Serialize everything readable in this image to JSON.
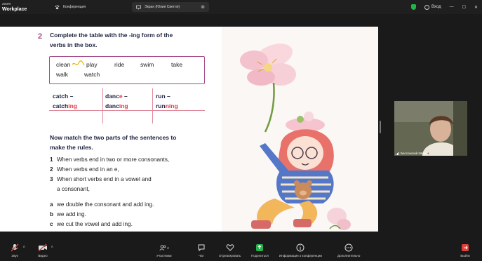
{
  "titlebar": {
    "brand_top": "zoom",
    "brand_main": "Workplace",
    "tab1_label": "Конференция",
    "tab2_label": "Экран (Юлия Светля)",
    "tab2_close": "⊗",
    "account_label": "Вход"
  },
  "exercise": {
    "number": "2",
    "instruction_line1": "Complete the table with the -ing form of the",
    "instruction_line2": "verbs in the box.",
    "box_words": [
      "clean",
      "play",
      "ride",
      "swim",
      "take",
      "walk",
      "watch"
    ],
    "table": [
      {
        "base": "catch –",
        "stem": "catch",
        "suffix": "ing"
      },
      {
        "base_pre": "danc",
        "base_red": "e",
        "base_post": " –",
        "stem": "danc",
        "suffix": "ing"
      },
      {
        "base": "run –",
        "stem": "run",
        "suffix": "ning"
      }
    ],
    "match_line1": "Now match the two parts of the sentences to",
    "match_line2": "make the rules.",
    "rules": [
      {
        "label": "1",
        "text": "When verbs end in two or more consonants,"
      },
      {
        "label": "2",
        "text": "When verbs end in an e,"
      },
      {
        "label": "3",
        "text": "When short verbs end in a vowel and"
      },
      {
        "label": "",
        "text": "a consonant,"
      }
    ],
    "answers": [
      {
        "label": "a",
        "text": "we double the consonant and add ing."
      },
      {
        "label": "b",
        "text": "we add ing."
      },
      {
        "label": "c",
        "text": "we cut the vowel and add ing."
      }
    ]
  },
  "video": {
    "participant_name": "Бессонский Иван"
  },
  "toolbar": {
    "audio": "Звук",
    "video": "Видео",
    "participants": "Участники",
    "participants_count": "2",
    "chat": "Чат",
    "react": "Отреагировать",
    "share": "Поделиться",
    "info": "Информация о конференции",
    "more": "Дополнительно",
    "leave": "Выйти"
  },
  "colors": {
    "accent_purple": "#a54a8a",
    "highlight_red": "#e23b45",
    "share_green": "#24b34a",
    "muted_red": "#e0403a"
  }
}
